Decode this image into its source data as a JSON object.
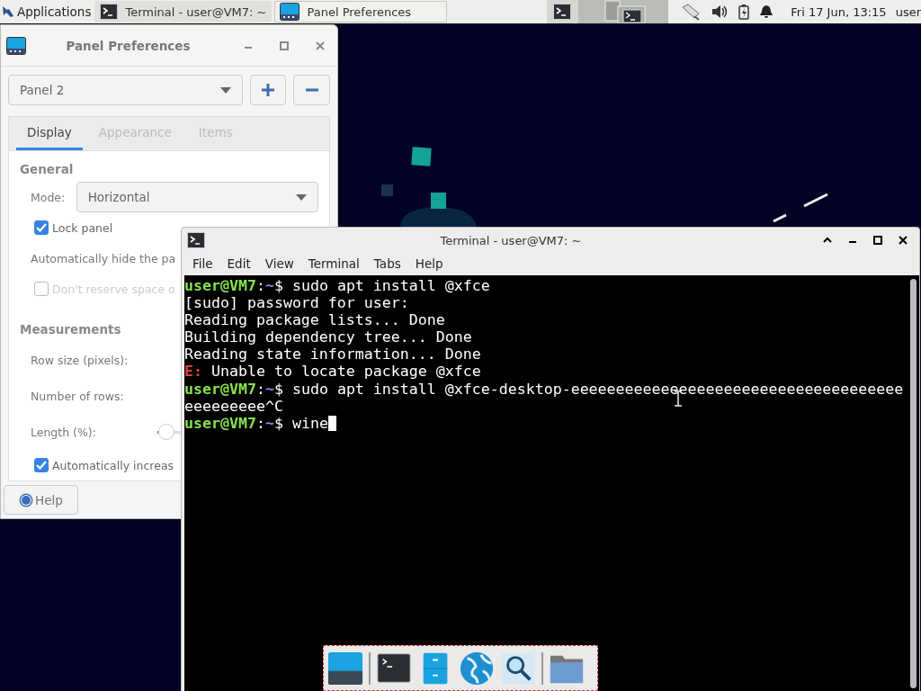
{
  "top_panel": {
    "applications_label": "Applications",
    "tasks": [
      {
        "title": "Terminal - user@VM7: ~",
        "kind": "terminal",
        "selected": false
      },
      {
        "title": "Panel Preferences",
        "kind": "panel",
        "selected": true
      }
    ],
    "workspaces": [
      {
        "selected": false
      },
      {
        "selected": true
      }
    ],
    "clock": "Fri 17 Jun, 13:15",
    "user": "user"
  },
  "panel_preferences": {
    "title": "Panel Preferences",
    "panel_select": "Panel 2",
    "tabs": [
      {
        "label": "Display",
        "selected": true,
        "disabled": false
      },
      {
        "label": "Appearance",
        "selected": false,
        "disabled": true
      },
      {
        "label": "Items",
        "selected": false,
        "disabled": true
      }
    ],
    "sections": [
      {
        "heading": "General",
        "rows": [
          {
            "kind": "combo",
            "label": "Mode:",
            "value": "Horizontal"
          },
          {
            "kind": "checkbox",
            "label": "Lock panel",
            "checked": true,
            "disabled": false
          },
          {
            "kind": "label",
            "label": "Automatically hide the pa"
          },
          {
            "kind": "checkbox",
            "label": "Don't reserve space o",
            "checked": false,
            "disabled": true
          }
        ]
      },
      {
        "heading": "Measurements",
        "rows": [
          {
            "kind": "label",
            "label": "Row size (pixels):"
          },
          {
            "kind": "label",
            "label": "Number of rows:"
          },
          {
            "kind": "slider",
            "label": "Length (%):",
            "level": 0.08
          },
          {
            "kind": "checkbox",
            "label": "Automatically increas",
            "checked": true,
            "disabled": false
          }
        ]
      }
    ],
    "help_button": "Help"
  },
  "terminal": {
    "title": "Terminal - user@VM7: ~",
    "menu": [
      "File",
      "Edit",
      "View",
      "Terminal",
      "Tabs",
      "Help"
    ],
    "lines": [
      {
        "kind": "prompt",
        "user_host": "user@VM7",
        "separator": ":",
        "path": "~",
        "symbol": "$",
        "command": "sudo apt install @xfce",
        "cursor": false
      },
      {
        "kind": "output",
        "text": "[sudo] password for user:"
      },
      {
        "kind": "output",
        "text": "Reading package lists... Done"
      },
      {
        "kind": "output",
        "text": "Building dependency tree... Done"
      },
      {
        "kind": "output",
        "text": "Reading state information... Done"
      },
      {
        "kind": "error",
        "tag": "E:",
        "text": "Unable to locate package @xfce"
      },
      {
        "kind": "prompt",
        "user_host": "user@VM7",
        "separator": ":",
        "path": "~",
        "symbol": "$",
        "command": "sudo apt install @xfce-desktop-eeeeeeeeeeeeeeeeeeeeeeeeeeeeeeeeeeeee",
        "cursor": false
      },
      {
        "kind": "output",
        "text": "eeeeeeeee^C"
      },
      {
        "kind": "prompt",
        "user_host": "user@VM7",
        "separator": ":",
        "path": "~",
        "symbol": "$",
        "command": "wine",
        "cursor": true
      }
    ]
  }
}
